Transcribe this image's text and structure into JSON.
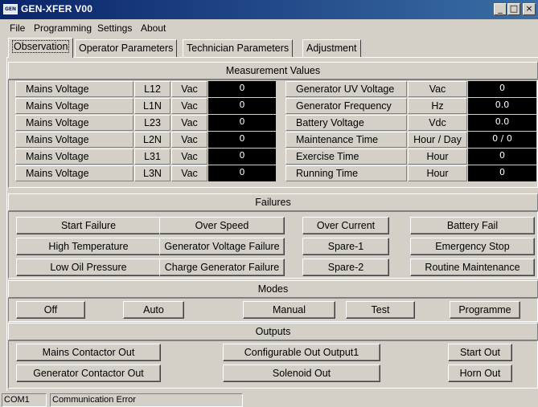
{
  "window": {
    "title": "GEN-XFER V00",
    "icon_text": "GEN",
    "minimize_glyph": "_",
    "maximize_glyph": "□",
    "close_glyph": "×"
  },
  "menu": [
    {
      "label": "File"
    },
    {
      "label": "Programming"
    },
    {
      "label": "Settings"
    },
    {
      "label": "About"
    }
  ],
  "tabs": [
    {
      "label": "Observation",
      "active": true
    },
    {
      "label": "Operator Parameters"
    },
    {
      "label": "Technician Parameters"
    },
    {
      "label": "Adjustment"
    }
  ],
  "measurement": {
    "title": "Measurement Values",
    "left_rows": [
      {
        "name": "Mains Voltage",
        "phase": "L12",
        "unit": "Vac",
        "value": "0"
      },
      {
        "name": "Mains Voltage",
        "phase": "L1N",
        "unit": "Vac",
        "value": "0"
      },
      {
        "name": "Mains Voltage",
        "phase": "L23",
        "unit": "Vac",
        "value": "0"
      },
      {
        "name": "Mains Voltage",
        "phase": "L2N",
        "unit": "Vac",
        "value": "0"
      },
      {
        "name": "Mains Voltage",
        "phase": "L31",
        "unit": "Vac",
        "value": "0"
      },
      {
        "name": "Mains Voltage",
        "phase": "L3N",
        "unit": "Vac",
        "value": "0"
      }
    ],
    "right_rows": [
      {
        "name": "Generator UV Voltage",
        "unit": "Vac",
        "value": "0"
      },
      {
        "name": "Generator Frequency",
        "unit": "Hz",
        "value": "0.0"
      },
      {
        "name": "Battery Voltage",
        "unit": "Vdc",
        "value": "0.0"
      },
      {
        "name": "Maintenance Time",
        "unit": "Hour / Day",
        "value": "0 / 0"
      },
      {
        "name": "Exercise Time",
        "unit": "Hour",
        "value": "0"
      },
      {
        "name": "Running Time",
        "unit": "Hour",
        "value": "0"
      }
    ]
  },
  "failures": {
    "title": "Failures",
    "items": [
      "Start Failure",
      "Over Speed",
      "Over Current",
      "Battery Fail",
      "High Temperature",
      "Generator Voltage Failure",
      "Spare-1",
      "Emergency Stop",
      "Low Oil Pressure",
      "Charge Generator Failure",
      "Spare-2",
      "Routine Maintenance"
    ]
  },
  "modes": {
    "title": "Modes",
    "items": [
      "Off",
      "Auto",
      "Manual",
      "Test",
      "Programme"
    ]
  },
  "outputs": {
    "title": "Outputs",
    "items": [
      "Mains Contactor Out",
      "Configurable Out Output1",
      "Start Out",
      "Generator Contactor Out",
      "Solenoid Out",
      "Horn Out"
    ]
  },
  "status": {
    "port": "COM1",
    "message": "Communication Error"
  }
}
